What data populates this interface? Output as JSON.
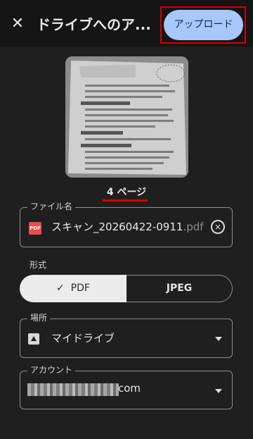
{
  "header": {
    "title": "ドライブへのア...",
    "upload_label": "アップロード",
    "close_icon": "✕"
  },
  "preview": {
    "page_count": "4 ページ"
  },
  "filename": {
    "label": "ファイル名",
    "name": "スキャン_20260422-0911",
    "extension": ".pdf",
    "icon_label": "PDF"
  },
  "format": {
    "label": "形式",
    "options": [
      {
        "label": "PDF",
        "selected": true,
        "check": "✓"
      },
      {
        "label": "JPEG",
        "selected": false
      }
    ]
  },
  "location": {
    "label": "場所",
    "value": "マイドライブ"
  },
  "account": {
    "label": "アカウント",
    "value_visible": "com"
  },
  "colors": {
    "background": "#1f1f1f",
    "topbar": "#151515",
    "upload_button": "#a8c7fa",
    "highlight": "#d40000",
    "pdf_icon": "#ec4b4b"
  }
}
